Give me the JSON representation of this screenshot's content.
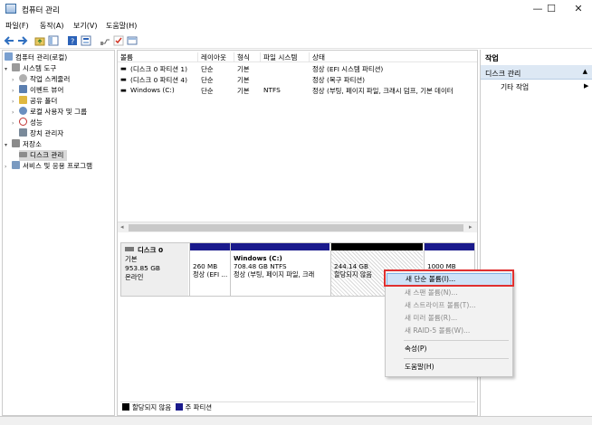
{
  "window": {
    "title": "컴퓨터 관리",
    "controls": {
      "minimize": "—",
      "maximize": "☐",
      "close": "✕"
    }
  },
  "menu": [
    "파일(F)",
    "동작(A)",
    "보기(V)",
    "도움말(H)"
  ],
  "tree": {
    "root": "컴퓨터 관리(로컬)",
    "system_tools": "시스템 도구",
    "task_scheduler": "작업 스케줄러",
    "event_viewer": "이벤트 뷰어",
    "shared_folders": "공유 폴더",
    "local_users": "로컬 사용자 및 그룹",
    "performance": "성능",
    "device_manager": "장치 관리자",
    "storage": "저장소",
    "disk_management": "디스크 관리",
    "services": "서비스 및 응용 프로그램"
  },
  "volume_list": {
    "headers": [
      "볼륨",
      "레이아웃",
      "형식",
      "파일 시스템",
      "상태"
    ],
    "rows": [
      {
        "volume": "(디스크 0 파티션 1)",
        "layout": "단순",
        "type": "기본",
        "fs": "",
        "status": "정상 (EFI 시스템 파티션)"
      },
      {
        "volume": "(디스크 0 파티션 4)",
        "layout": "단순",
        "type": "기본",
        "fs": "",
        "status": "정상 (복구 파티션)"
      },
      {
        "volume": "Windows (C:)",
        "layout": "단순",
        "type": "기본",
        "fs": "NTFS",
        "status": "정상 (부팅, 페이지 파일, 크래시 덤프, 기본 데이터"
      }
    ]
  },
  "disk": {
    "name": "디스크 0",
    "type": "기본",
    "size": "953.85 GB",
    "state": "온라인",
    "partitions": [
      {
        "size": "260 MB",
        "status": "정상 (EFI ..."
      },
      {
        "name": "Windows  (C:)",
        "size": "708.48 GB NTFS",
        "status": "정상 (부팅, 페이지 파일, 크래"
      },
      {
        "size": "244.14 GB",
        "status": "할당되지 않음"
      },
      {
        "size": "1000 MB"
      }
    ]
  },
  "legend": {
    "unallocated": "할당되지 않음",
    "primary": "주 파티션"
  },
  "actions": {
    "header": "작업",
    "section": "디스크 관리",
    "more": "기타 작업"
  },
  "context_menu": {
    "items": [
      "새 단순 볼륨(I)...",
      "새 스팬 볼륨(N)...",
      "새 스트라이프 볼륨(T)...",
      "새 미러 볼륨(R)...",
      "새 RAID-5 볼륨(W)...",
      "속성(P)",
      "도움말(H)"
    ]
  },
  "colors": {
    "primary_partition": "#1a1a8c",
    "unallocated": "#000000",
    "highlight": "#cfe2f7",
    "annotation": "#e03030"
  }
}
